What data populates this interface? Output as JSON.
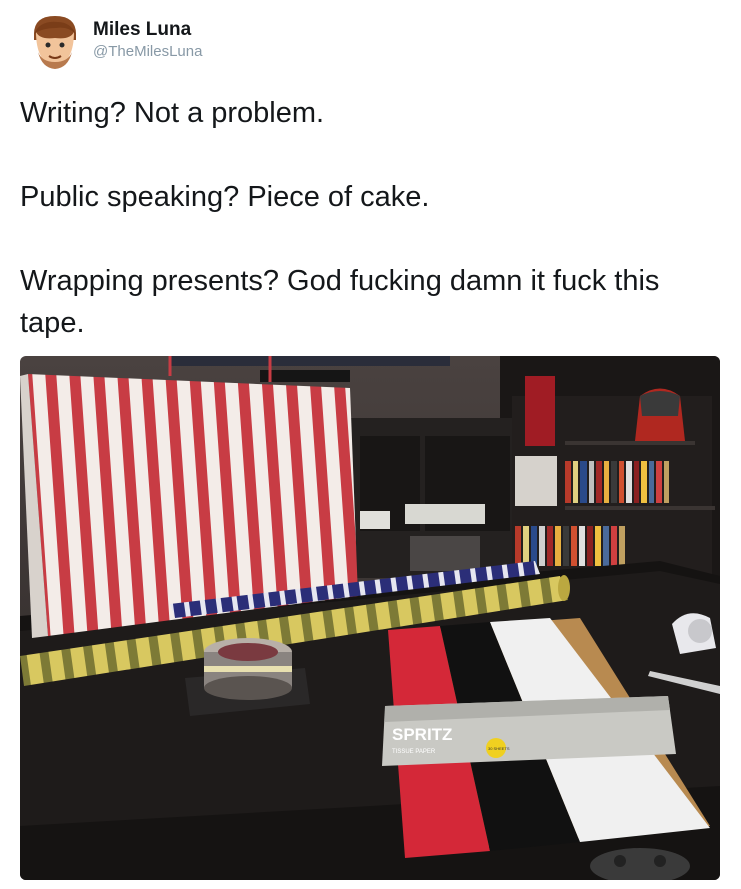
{
  "tweet": {
    "author": {
      "display_name": "Miles Luna",
      "handle": "@TheMilesLuna"
    },
    "lines": [
      "Writing? Not a problem.",
      "Public speaking? Piece of cake.",
      "Wrapping presents? God fucking damn it fuck this tape."
    ],
    "photo": {
      "product_label": "SPRITZ",
      "product_sub": "TISSUE PAPER",
      "badge": "30 SHEETS"
    }
  }
}
